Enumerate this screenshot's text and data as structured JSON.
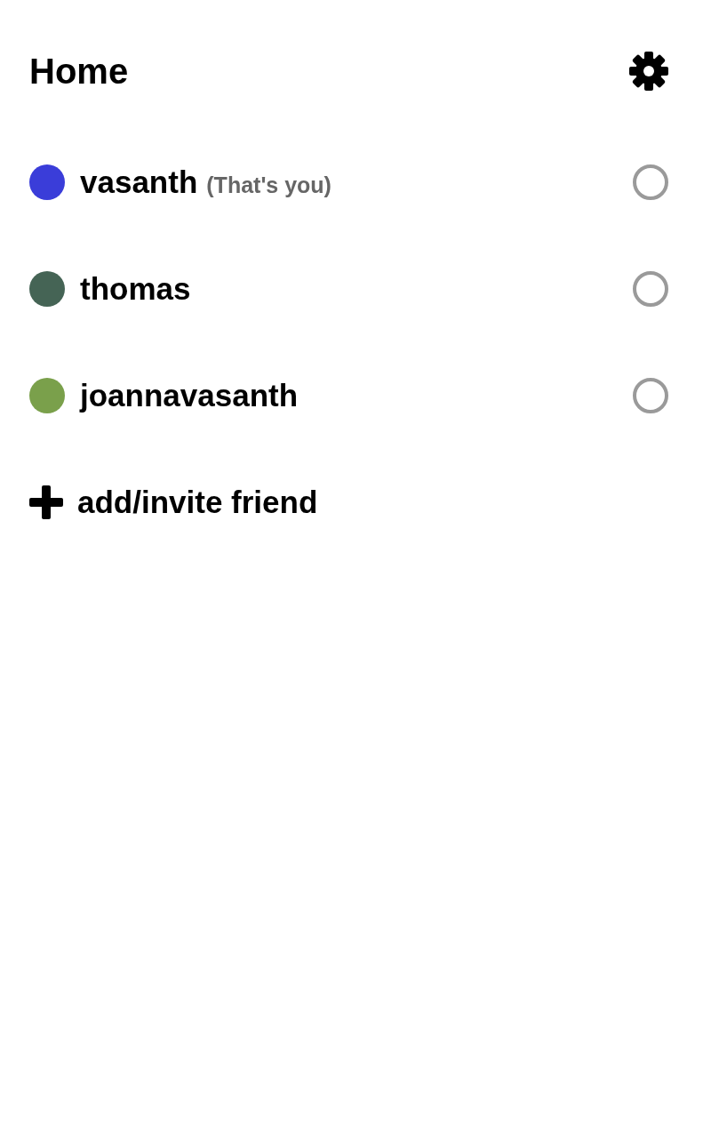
{
  "header": {
    "title": "Home"
  },
  "friends": [
    {
      "name": "vasanth",
      "note": "(That's you)",
      "color": "#3a3dd9",
      "selected": false
    },
    {
      "name": "thomas",
      "color": "#456455",
      "selected": false
    },
    {
      "name": "joannavasanth",
      "color": "#7aa04b",
      "selected": false
    }
  ],
  "add_action": {
    "label": "add/invite friend"
  }
}
